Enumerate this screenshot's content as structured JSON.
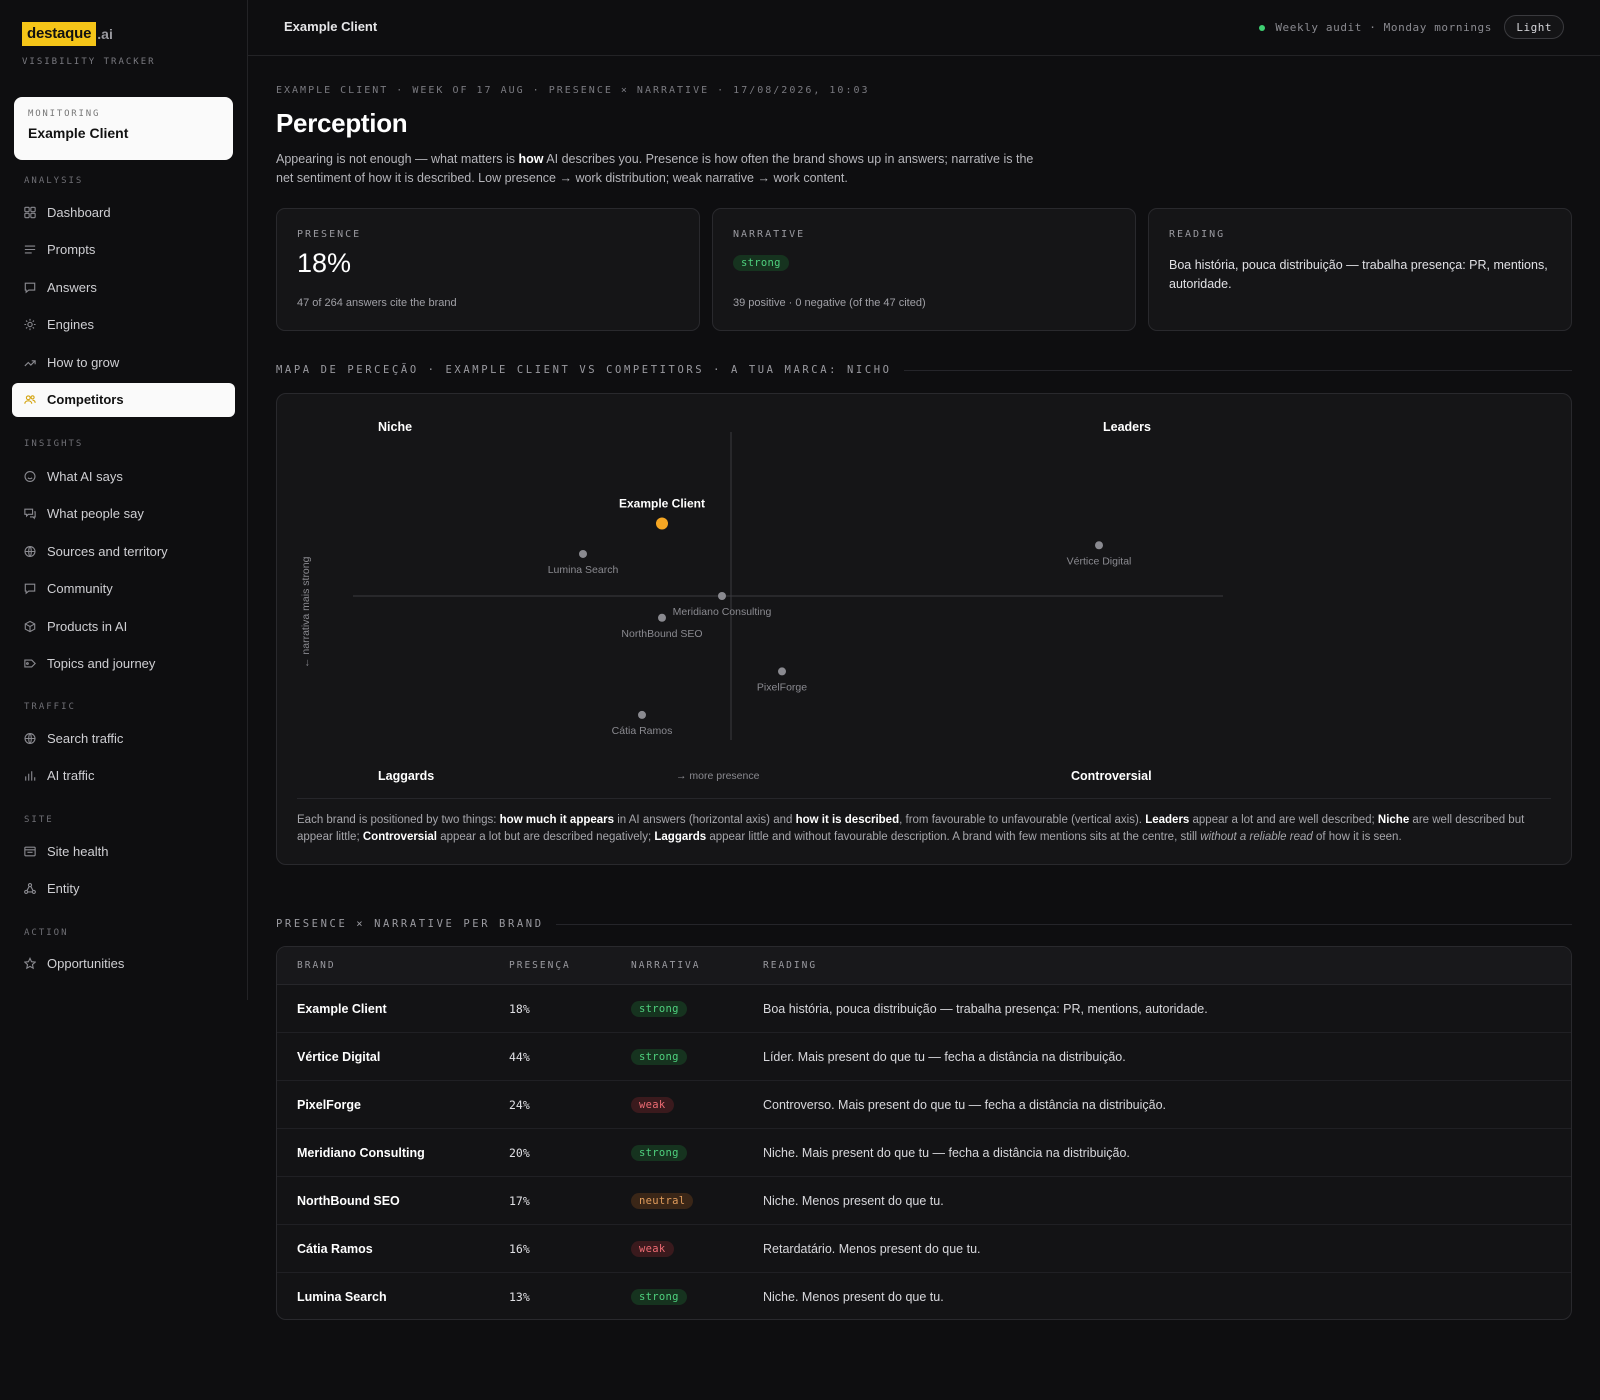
{
  "brand": {
    "logo_main": "destaque",
    "logo_suffix": ".ai",
    "tagline": "VISIBILITY TRACKER"
  },
  "monitoring": {
    "label": "MONITORING",
    "client": "Example Client"
  },
  "nav": {
    "analysis_title": "ANALYSIS",
    "analysis": [
      {
        "label": "Dashboard",
        "icon": "grid-icon"
      },
      {
        "label": "Prompts",
        "icon": "lines-icon"
      },
      {
        "label": "Answers",
        "icon": "chat-icon"
      },
      {
        "label": "Engines",
        "icon": "sun-icon"
      },
      {
        "label": "How to grow",
        "icon": "trend-icon"
      },
      {
        "label": "Competitors",
        "icon": "users-icon",
        "active": true
      }
    ],
    "insights_title": "INSIGHTS",
    "insights": [
      {
        "label": "What AI says",
        "icon": "ai-icon"
      },
      {
        "label": "What people say",
        "icon": "people-chat-icon"
      },
      {
        "label": "Sources and territory",
        "icon": "globe-icon"
      },
      {
        "label": "Community",
        "icon": "chat-icon"
      },
      {
        "label": "Products in AI",
        "icon": "box-icon"
      },
      {
        "label": "Topics and journey",
        "icon": "tag-icon"
      }
    ],
    "traffic_title": "TRAFFIC",
    "traffic": [
      {
        "label": "Search traffic",
        "icon": "globe-icon"
      },
      {
        "label": "AI traffic",
        "icon": "bars-icon"
      }
    ],
    "site_title": "SITE",
    "site": [
      {
        "label": "Site health",
        "icon": "window-icon"
      },
      {
        "label": "Entity",
        "icon": "nodes-icon"
      }
    ],
    "action_title": "ACTION",
    "action": [
      {
        "label": "Opportunities",
        "icon": "star-icon"
      }
    ]
  },
  "topbar": {
    "title": "Example Client",
    "audit": "Weekly audit · Monday mornings",
    "theme_button": "Light"
  },
  "page": {
    "meta": "EXAMPLE CLIENT · WEEK OF 17 AUG · PRESENCE × NARRATIVE · 17/08/2026, 10:03",
    "title": "Perception",
    "intro_before": "Appearing is not enough — what matters is ",
    "intro_bold": "how",
    "intro_after": " AI describes you. Presence is how often the brand shows up in answers; narrative is the net sentiment of how it is described. Low presence → work distribution; weak narrative → work content."
  },
  "cards": {
    "presence": {
      "label": "PRESENCE",
      "value": "18%",
      "sub": "47 of 264 answers cite the brand"
    },
    "narrative": {
      "label": "NARRATIVE",
      "value": "strong",
      "sub": "39 positive · 0 negative (of the 47 cited)"
    },
    "reading": {
      "label": "READING",
      "text": "Boa história, pouca distribuição — trabalha presença: PR, mentions, autoridade."
    }
  },
  "map": {
    "section_title": "MAPA DE PERCEÇÃO · EXAMPLE CLIENT VS COMPETITORS · A TUA MARCA: NICHO",
    "quadrants": {
      "top_left": "Niche",
      "top_right": "Leaders",
      "bottom_left": "Laggards",
      "bottom_right": "Controversial"
    },
    "x_axis": "→ more presence",
    "y_axis": "← narrativa mais strong",
    "note": {
      "p1": "Each brand is positioned by two things: ",
      "b1": "how much it appears",
      "p2": " in AI answers (horizontal axis) and ",
      "b2": "how it is described",
      "p3": ", from favourable to unfavourable (vertical axis). ",
      "b3": "Leaders",
      "p4": " appear a lot and are well described; ",
      "b4": "Niche",
      "p5": " are well described but appear little; ",
      "b5": "Controversial",
      "p6": " appear a lot but are described negatively; ",
      "b6": "Laggards",
      "p7": " appear little and without favourable description. A brand with few mentions sits at the centre, still ",
      "i1": "without a reliable read",
      "p8": " of how it is seen."
    }
  },
  "chart_data": {
    "type": "scatter",
    "x_label": "→ more presence",
    "y_label": "← narrativa mais strong",
    "x_unit": "presence %",
    "points": [
      {
        "name": "Example Client",
        "presence": 18,
        "narrative": 0.5,
        "highlight": true,
        "color": "#f5a623"
      },
      {
        "name": "Lumina Search",
        "presence": 13,
        "narrative": 0.29
      },
      {
        "name": "Vértice Digital",
        "presence": 44,
        "narrative": 0.35
      },
      {
        "name": "Meridiano Consulting",
        "presence": 20,
        "narrative": 0.0
      },
      {
        "name": "NorthBound SEO",
        "presence": 17,
        "narrative": -0.15
      },
      {
        "name": "PixelForge",
        "presence": 24,
        "narrative": -0.52
      },
      {
        "name": "Cátia Ramos",
        "presence": 16,
        "narrative": -0.82
      }
    ],
    "x_range": [
      5,
      55
    ],
    "y_range": [
      -1,
      1
    ]
  },
  "table": {
    "section_title": "PRESENCE × NARRATIVE PER BRAND",
    "headers": [
      "BRAND",
      "PRESENÇA",
      "NARRATIVA",
      "READING"
    ],
    "rows": [
      {
        "brand": "Example Client",
        "presence": "18%",
        "narrative": "strong",
        "reading": "Boa história, pouca distribuição — trabalha presença: PR, mentions, autoridade."
      },
      {
        "brand": "Vértice Digital",
        "presence": "44%",
        "narrative": "strong",
        "reading": "Líder. Mais present do que tu — fecha a distância na distribuição."
      },
      {
        "brand": "PixelForge",
        "presence": "24%",
        "narrative": "weak",
        "reading": "Controverso. Mais present do que tu — fecha a distância na distribuição."
      },
      {
        "brand": "Meridiano Consulting",
        "presence": "20%",
        "narrative": "strong",
        "reading": "Niche. Mais present do que tu — fecha a distância na distribuição."
      },
      {
        "brand": "NorthBound SEO",
        "presence": "17%",
        "narrative": "neutral",
        "reading": "Niche. Menos present do que tu."
      },
      {
        "brand": "Cátia Ramos",
        "presence": "16%",
        "narrative": "weak",
        "reading": "Retardatário. Menos present do que tu."
      },
      {
        "brand": "Lumina Search",
        "presence": "13%",
        "narrative": "strong",
        "reading": "Niche. Menos present do que tu."
      }
    ]
  }
}
